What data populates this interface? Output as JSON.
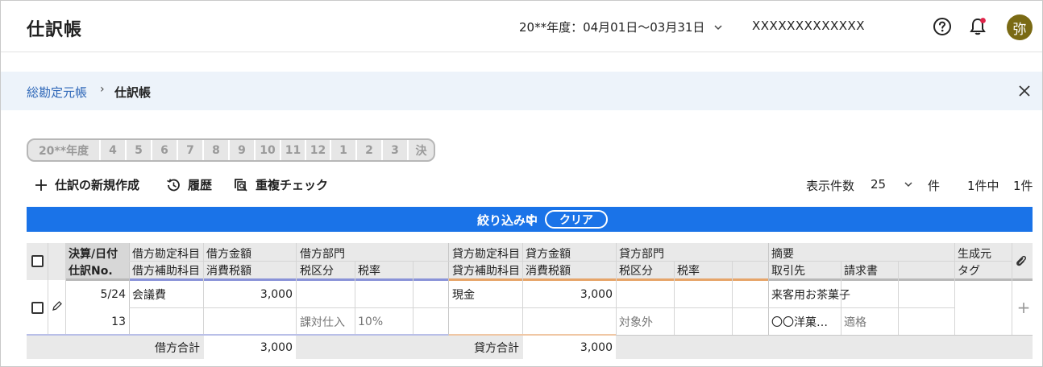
{
  "app": {
    "title": "仕訳帳",
    "period": "20**年度：04月01日〜03月31日",
    "company": "XXXXXXXXXXXXX",
    "avatar_char": "弥"
  },
  "breadcrumb": {
    "parent": "総勘定元帳",
    "current": "仕訳帳"
  },
  "period_tabs": [
    "20**年度",
    "4",
    "5",
    "6",
    "7",
    "8",
    "9",
    "10",
    "11",
    "12",
    "1",
    "2",
    "3",
    "決"
  ],
  "toolbar": {
    "new_entry": "仕訳の新規作成",
    "history": "履歴",
    "duplicate_check": "重複チェック",
    "per_page_label": "表示件数",
    "per_page_value": "25",
    "per_page_unit": "件",
    "count_text": "1件中",
    "count_total": "1件"
  },
  "filter": {
    "label": "絞り込み中",
    "clear": "クリア"
  },
  "table": {
    "headers": {
      "date": "決算/日付",
      "entry_no": "仕訳No.",
      "debit_account": "借方勘定科目",
      "debit_sub": "借方補助科目",
      "debit_amount": "借方金額",
      "debit_tax_amount": "消費税額",
      "debit_dept": "借方部門",
      "debit_tax_class": "税区分",
      "debit_tax_rate": "税率",
      "credit_account": "貸方勘定科目",
      "credit_sub": "貸方補助科目",
      "credit_amount": "貸方金額",
      "credit_tax_amount": "消費税額",
      "credit_dept": "貸方部門",
      "credit_tax_class": "税区分",
      "credit_tax_rate": "税率",
      "memo": "摘要",
      "partner": "取引先",
      "invoice": "請求書",
      "source": "生成元",
      "tag": "タグ"
    },
    "row": {
      "date": "5/24",
      "entry_no": "13",
      "debit_account": "会議費",
      "debit_amount": "3,000",
      "debit_tax_class": "課対仕入",
      "debit_tax_rate": "10%",
      "credit_account": "現金",
      "credit_amount": "3,000",
      "credit_tax_class": "対象外",
      "memo": "来客用お茶菓子",
      "partner": "〇〇洋菓…",
      "invoice": "適格"
    },
    "totals": {
      "debit_label": "借方合計",
      "debit_value": "3,000",
      "credit_label": "貸方合計",
      "credit_value": "3,000"
    }
  },
  "colors": {
    "brand_blue": "#1a73e8",
    "debit_accent": "#8a93d8",
    "credit_accent": "#e6a56a",
    "notification_dot": "#e0244a",
    "avatar_bg": "#7a6a14"
  },
  "icons": [
    "help-icon",
    "bell-icon",
    "close-icon",
    "plus-icon",
    "history-icon",
    "duplicate-check-icon",
    "chevron-down-icon",
    "double-chevron-down-icon",
    "pencil-icon",
    "paperclip-icon"
  ]
}
